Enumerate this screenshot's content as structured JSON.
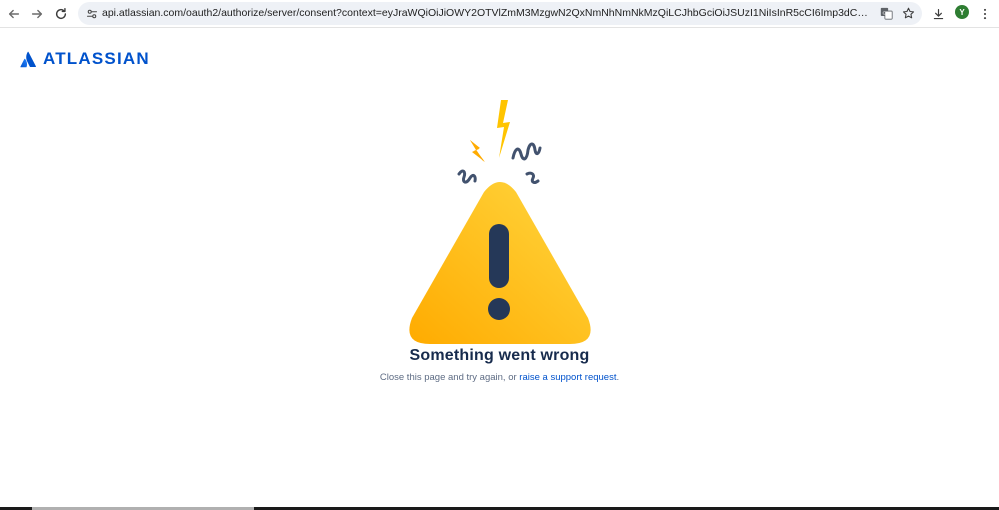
{
  "browser": {
    "url": "api.atlassian.com/oauth2/authorize/server/consent?context=eyJraWQiOiJiOWY2OTVlZmM3MzgwN2QxNmNhNmNkMzQiLCJhbGciOiJSUzI1NiIsInR5cCI6Imp3dCJ9.eyJuYmYiOjE3NDc4OTQyM...",
    "profile_initial": "Y",
    "profile_color": "#2e7d32"
  },
  "brand": {
    "name": "ATLASSIAN",
    "color": "#0052cc"
  },
  "error": {
    "title": "Something went wrong",
    "message_prefix": "Close this page and try again, or ",
    "link_text": "raise a support request",
    "message_suffix": "."
  },
  "colors": {
    "warning_yellow": "#ffc400",
    "warning_orange": "#ffab00",
    "dark_navy": "#253858",
    "text_primary": "#172b4d",
    "text_secondary": "#5e6c84"
  }
}
